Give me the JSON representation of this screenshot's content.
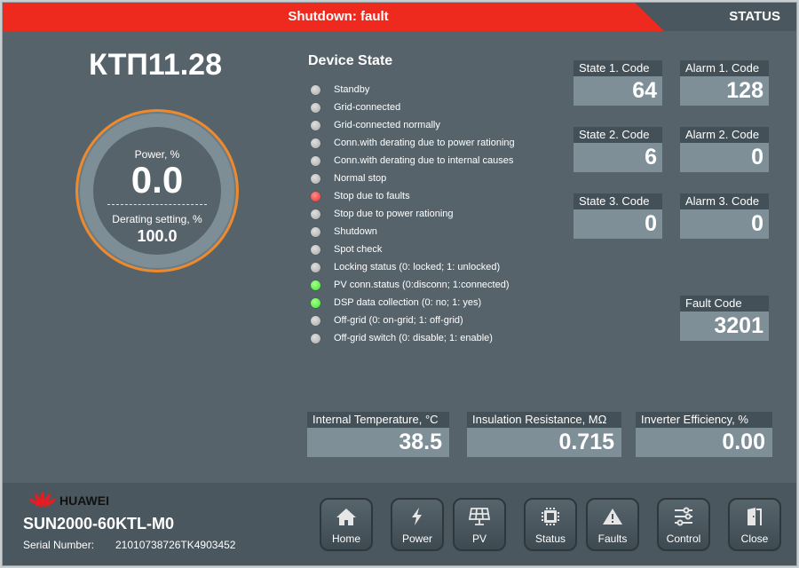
{
  "header": {
    "status_title": "Shutdown: fault",
    "section": "STATUS"
  },
  "station": {
    "name": "КТП11.28"
  },
  "gauge": {
    "power_label": "Power, %",
    "power_value": "0.0",
    "derating_label": "Derating setting, %",
    "derating_value": "100.0"
  },
  "device_state": {
    "title": "Device State",
    "items": [
      {
        "label": "Standby",
        "state": "off"
      },
      {
        "label": "Grid-connected",
        "state": "off"
      },
      {
        "label": "Grid-connected normally",
        "state": "off"
      },
      {
        "label": "Conn.with derating due to power rationing",
        "state": "off"
      },
      {
        "label": "Conn.with derating due to internal causes",
        "state": "off"
      },
      {
        "label": "Normal stop",
        "state": "off"
      },
      {
        "label": "Stop due to faults",
        "state": "fault"
      },
      {
        "label": "Stop due to power rationing",
        "state": "off"
      },
      {
        "label": "Shutdown",
        "state": "off"
      },
      {
        "label": "Spot check",
        "state": "off"
      },
      {
        "label": "Locking status (0: locked; 1: unlocked)",
        "state": "off"
      },
      {
        "label": "PV conn.status (0:disconn; 1:connected)",
        "state": "on"
      },
      {
        "label": "DSP data collection (0: no; 1: yes)",
        "state": "on"
      },
      {
        "label": "Off-grid (0: on-grid; 1: off-grid)",
        "state": "off"
      },
      {
        "label": "Off-grid switch (0: disable; 1: enable)",
        "state": "off"
      }
    ]
  },
  "codes": {
    "state1": {
      "label": "State 1. Code",
      "value": "64"
    },
    "alarm1": {
      "label": "Alarm 1. Code",
      "value": "128"
    },
    "state2": {
      "label": "State 2. Code",
      "value": "6"
    },
    "alarm2": {
      "label": "Alarm 2. Code",
      "value": "0"
    },
    "state3": {
      "label": "State 3. Code",
      "value": "0"
    },
    "alarm3": {
      "label": "Alarm 3. Code",
      "value": "0"
    },
    "fault": {
      "label": "Fault Code",
      "value": "3201"
    }
  },
  "metrics": {
    "temperature": {
      "label": "Internal Temperature, °C",
      "value": "38.5"
    },
    "insulation": {
      "label": "Insulation Resistance, MΩ",
      "value": "0.715"
    },
    "efficiency": {
      "label": "Inverter Efficiency, %",
      "value": "0.00"
    }
  },
  "device": {
    "brand": "HUAWEI",
    "model": "SUN2000-60KTL-M0",
    "serial_label": "Serial Number:",
    "serial_value": "21010738726TK4903452"
  },
  "nav": {
    "home": "Home",
    "power": "Power",
    "pv": "PV",
    "status": "Status",
    "faults": "Faults",
    "control": "Control",
    "close": "Close"
  },
  "colors": {
    "fault_red": "#ee2a1e",
    "gauge_orange": "#ef8a2c",
    "led_green": "#3ee62e",
    "led_red": "#ee3030"
  }
}
